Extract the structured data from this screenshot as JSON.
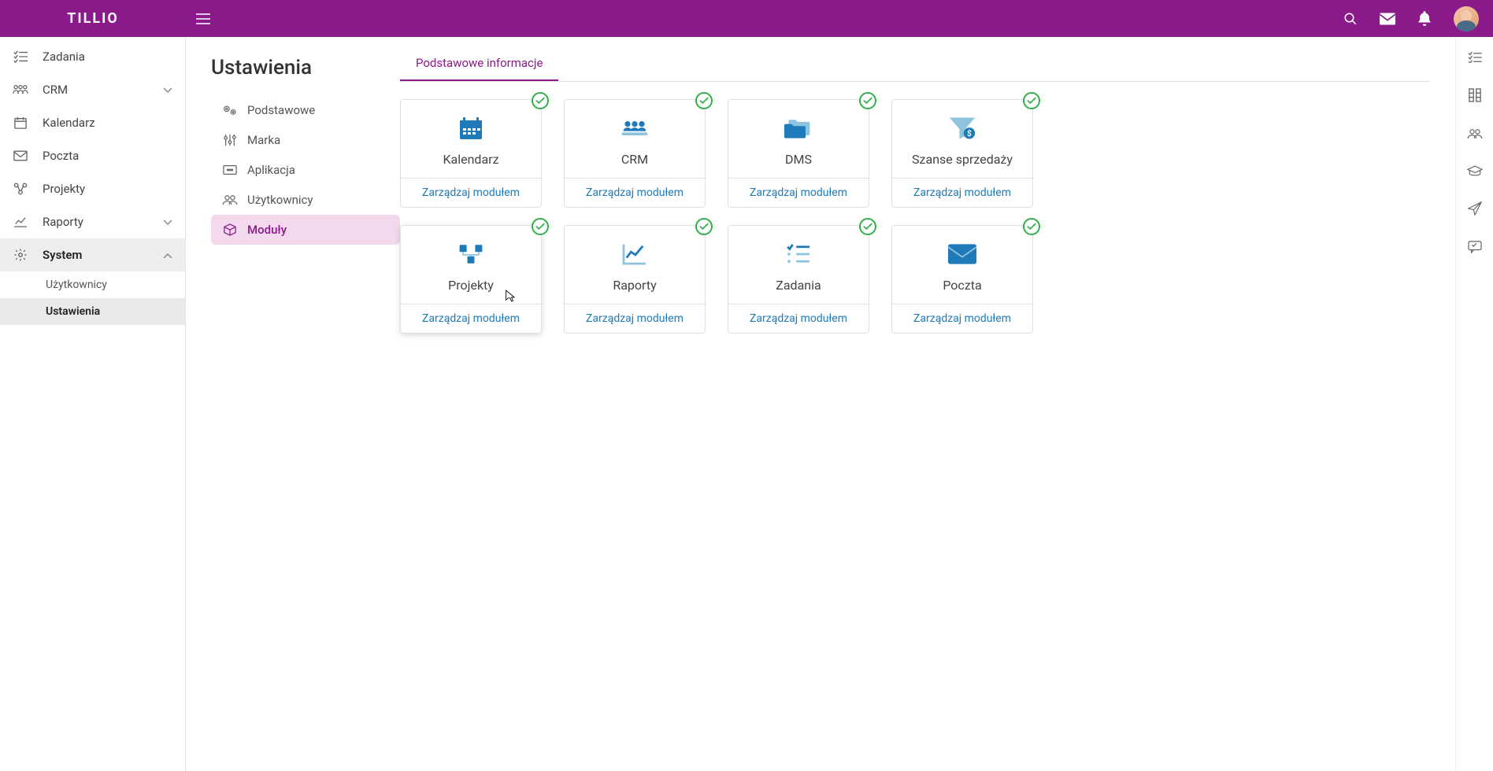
{
  "brand": "TILLIO",
  "sidebar": {
    "items": [
      {
        "label": "Zadania",
        "expandable": false
      },
      {
        "label": "CRM",
        "expandable": true,
        "expanded": false
      },
      {
        "label": "Kalendarz",
        "expandable": false
      },
      {
        "label": "Poczta",
        "expandable": false
      },
      {
        "label": "Projekty",
        "expandable": false
      },
      {
        "label": "Raporty",
        "expandable": true,
        "expanded": false
      },
      {
        "label": "System",
        "expandable": true,
        "expanded": true
      }
    ],
    "system_children": [
      {
        "label": "Użytkownicy",
        "active": false
      },
      {
        "label": "Ustawienia",
        "active": true
      }
    ]
  },
  "settings": {
    "title": "Ustawienia",
    "nav": [
      {
        "label": "Podstawowe"
      },
      {
        "label": "Marka"
      },
      {
        "label": "Aplikacja"
      },
      {
        "label": "Użytkownicy"
      },
      {
        "label": "Moduły",
        "active": true
      }
    ],
    "tab": "Podstawowe informacje",
    "manage_label": "Zarządzaj modułem",
    "modules": [
      {
        "name": "Kalendarz"
      },
      {
        "name": "CRM"
      },
      {
        "name": "DMS"
      },
      {
        "name": "Szanse sprzedaży"
      },
      {
        "name": "Projekty",
        "hovered": true
      },
      {
        "name": "Raporty"
      },
      {
        "name": "Zadania"
      },
      {
        "name": "Poczta"
      }
    ]
  }
}
